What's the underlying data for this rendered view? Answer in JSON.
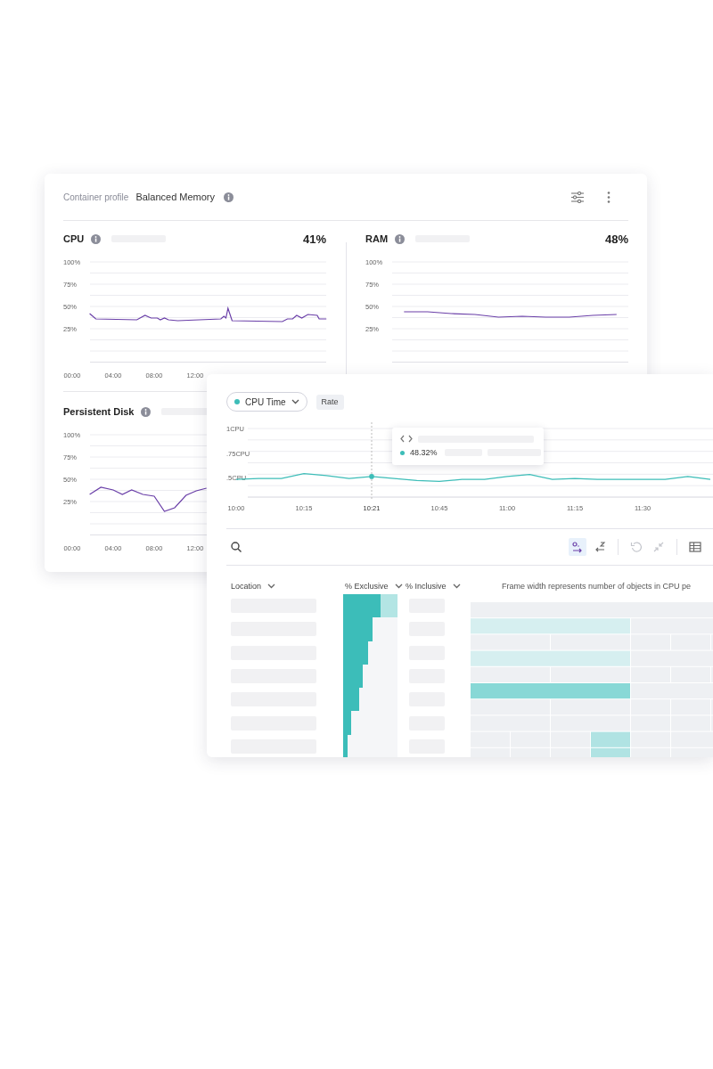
{
  "container_profile": {
    "label": "Container profile",
    "value": "Balanced Memory"
  },
  "metrics": [
    {
      "title": "CPU",
      "value": "41%",
      "chart_data": {
        "type": "line",
        "grid": true,
        "x": [
          1.7,
          2.3,
          6.3,
          7.1,
          7.7,
          8.3,
          8.6,
          9.0,
          9.4,
          10.3,
          14.5,
          14.8,
          15.0,
          15.2,
          15.6,
          20.5,
          21.0,
          21.5,
          21.9,
          22.4,
          23.0,
          23.9,
          24.1,
          24.8
        ],
        "xlim": [
          0,
          25
        ],
        "ylim": [
          -12.5,
          100
        ],
        "yticks": [
          {
            "value": 100,
            "label": "100%"
          },
          {
            "value": 75,
            "label": "75%"
          },
          {
            "value": 50,
            "label": "50%"
          },
          {
            "value": 25,
            "label": "25%"
          }
        ],
        "xticks": [
          {
            "value": 0,
            "label": "00:00"
          },
          {
            "value": 4,
            "label": "04:00"
          },
          {
            "value": 8,
            "label": "08:00"
          },
          {
            "value": 12,
            "label": "12:00"
          }
        ],
        "series": [
          {
            "color": "#6a3fa8",
            "values": [
              42,
              36,
              35,
              40,
              37,
              37,
              35,
              37,
              35,
              34,
              36,
              39,
              37,
              48,
              34,
              33,
              36,
              36,
              40,
              37,
              41,
              40,
              36,
              36
            ]
          }
        ]
      }
    },
    {
      "title": "RAM",
      "value": "48%",
      "chart_data": {
        "type": "line",
        "grid": true,
        "categories": [
          null,
          null,
          null,
          null,
          null,
          null,
          null,
          null,
          null,
          null
        ],
        "ylim": [
          -12.5,
          100
        ],
        "yticks": [
          {
            "value": 100,
            "label": "100%"
          },
          {
            "value": 75,
            "label": "75%"
          },
          {
            "value": 50,
            "label": "50%"
          },
          {
            "value": 25,
            "label": "25%"
          }
        ],
        "series": [
          {
            "color": "#6a3fa8",
            "values": [
              44,
              44,
              42,
              41,
              38,
              39,
              38,
              38,
              40,
              41
            ]
          }
        ]
      }
    },
    {
      "title": "Persistent Disk",
      "chart_data": {
        "type": "line",
        "grid": true,
        "x": [
          1.7,
          2.8,
          4.0,
          4.9,
          5.8,
          6.9,
          8.0,
          9.0,
          10.0,
          11.1,
          12.1,
          13.1
        ],
        "xlim": [
          0,
          25
        ],
        "ylim": [
          -12.5,
          100
        ],
        "yticks": [
          {
            "value": 100,
            "label": "100%"
          },
          {
            "value": 75,
            "label": "75%"
          },
          {
            "value": 50,
            "label": "50%"
          },
          {
            "value": 25,
            "label": "25%"
          }
        ],
        "xticks": [
          {
            "value": 0,
            "label": "00:00"
          },
          {
            "value": 4,
            "label": "04:00"
          },
          {
            "value": 8,
            "label": "08:00"
          },
          {
            "value": 12,
            "label": "12:00"
          }
        ],
        "series": [
          {
            "color": "#6a3fa8",
            "values": [
              33,
              41,
              38,
              33,
              38,
              33,
              31,
              14,
              18,
              32,
              37,
              40
            ]
          }
        ]
      }
    }
  ],
  "profiler": {
    "metric_dropdown": {
      "value": "CPU Time"
    },
    "mode_chip": "Rate",
    "chart_data": {
      "type": "line",
      "grid": true,
      "categories": [
        "10:00",
        null,
        null,
        "10:15",
        null,
        null,
        "10:21",
        null,
        null,
        "10:45",
        null,
        null,
        "11:00",
        null,
        null,
        "11:15",
        null,
        null,
        "11:30",
        null,
        null,
        null
      ],
      "ylim": [
        0.3,
        1
      ],
      "yticks": [
        {
          "value": 1,
          "label": "1CPU"
        },
        {
          "value": 0.75,
          "label": ".75CPU"
        },
        {
          "value": 0.5,
          "label": ".5CPU"
        }
      ],
      "series": [
        {
          "color": "#3dbdb8",
          "values": [
            0.48,
            0.49,
            0.49,
            0.54,
            0.52,
            0.49,
            0.51,
            0.49,
            0.47,
            0.46,
            0.48,
            0.48,
            0.51,
            0.53,
            0.48,
            0.49,
            0.48,
            0.48,
            0.48,
            0.48,
            0.51,
            0.48
          ]
        }
      ]
    },
    "tooltip": {
      "value": "48.32%"
    },
    "toolbar": [
      {
        "kind": "sort-asc",
        "selected": true
      },
      {
        "kind": "sort-desc",
        "selected": false
      },
      {
        "kind": "undo",
        "disabled": true
      },
      {
        "kind": "collapse",
        "disabled": true
      },
      {
        "kind": "table",
        "selected": false
      }
    ],
    "table": {
      "columns": [
        "Location",
        "% Exclusive",
        "% Inclusive"
      ],
      "caption": "Frame width represents number of objects in CPU pe",
      "rows": [
        {
          "level": 0.69,
          "selected": true
        },
        {
          "level": 0.54,
          "selected": false
        },
        {
          "level": 0.46,
          "selected": false
        },
        {
          "level": 0.36,
          "selected": false
        },
        {
          "level": 0.3,
          "selected": false
        },
        {
          "level": 0.15,
          "selected": false
        },
        {
          "level": 0.08,
          "selected": false
        }
      ]
    }
  }
}
